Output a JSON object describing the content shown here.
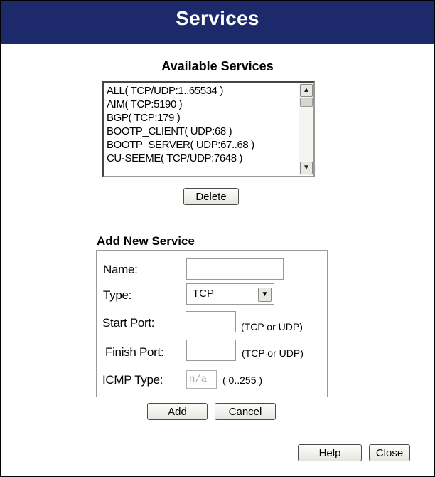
{
  "title": "Services",
  "available": {
    "heading": "Available Services",
    "items": [
      "ALL( TCP/UDP:1..65534 )",
      "AIM( TCP:5190 )",
      "BGP( TCP:179 )",
      "BOOTP_CLIENT( UDP:68 )",
      "BOOTP_SERVER( UDP:67..68 )",
      "CU-SEEME( TCP/UDP:7648 )"
    ],
    "delete_label": "Delete"
  },
  "add": {
    "heading": "Add New Service",
    "name_label": "Name:",
    "name_value": "",
    "type_label": "Type:",
    "type_value": "TCP",
    "start_label": "Start Port:",
    "start_value": "",
    "start_note": "(TCP or UDP)",
    "finish_label": "Finish Port:",
    "finish_value": "",
    "finish_note": "(TCP or UDP)",
    "icmp_label": "ICMP Type:",
    "icmp_placeholder": "n/a",
    "icmp_note": "( 0..255 )",
    "add_label": "Add",
    "cancel_label": "Cancel"
  },
  "footer": {
    "help_label": "Help",
    "close_label": "Close"
  }
}
